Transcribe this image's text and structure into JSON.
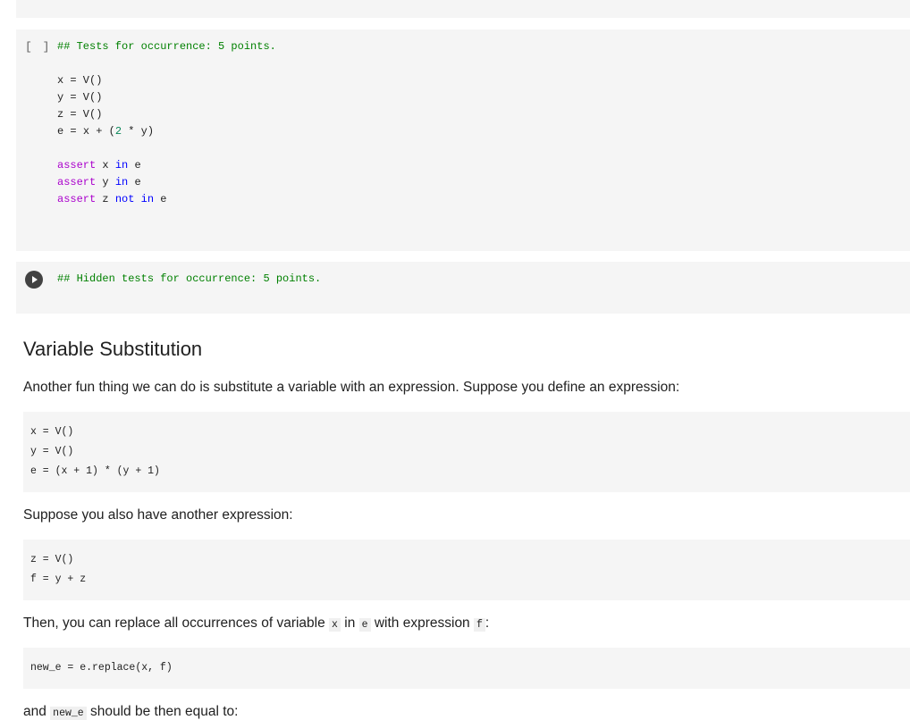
{
  "cells": {
    "tests": {
      "slot": "[ ]",
      "header_comment": "## Tests for occurrence: 5 points.",
      "lines": [
        "x = V()",
        "y = V()",
        "z = V()"
      ],
      "expr_e": "e",
      "expr_eq": "=",
      "expr_lhs": "x +",
      "expr_open": "(",
      "expr_num": "2",
      "expr_rest": " * y)",
      "asserts": [
        {
          "kw": "assert",
          "var": "x",
          "op": "in",
          "target": "e"
        },
        {
          "kw": "assert",
          "var": "y",
          "op": "in",
          "target": "e"
        },
        {
          "kw": "assert",
          "var": "z",
          "op": "not in",
          "target": "e"
        }
      ]
    },
    "hidden": {
      "comment": "## Hidden tests for occurrence: 5 points."
    }
  },
  "markdown": {
    "heading": "Variable Substitution",
    "p1": "Another fun thing we can do is substitute a variable with an expression. Suppose you define an expression:",
    "block1": [
      "x = V()",
      "y = V()",
      "e = (x + 1) * (y + 1)"
    ],
    "p2": "Suppose you also have another expression:",
    "block2": [
      "z = V()",
      "f = y + z"
    ],
    "p3": {
      "before": "Then, you can replace all occurrences of variable ",
      "code1": "x",
      "mid1": " in ",
      "code2": "e",
      "mid2": " with expression ",
      "code3": "f",
      "after": ":"
    },
    "block3": [
      "new_e = e.replace(x, f)"
    ],
    "p4": {
      "before": "and ",
      "code": "new_e",
      "after": " should be then equal to:"
    }
  }
}
